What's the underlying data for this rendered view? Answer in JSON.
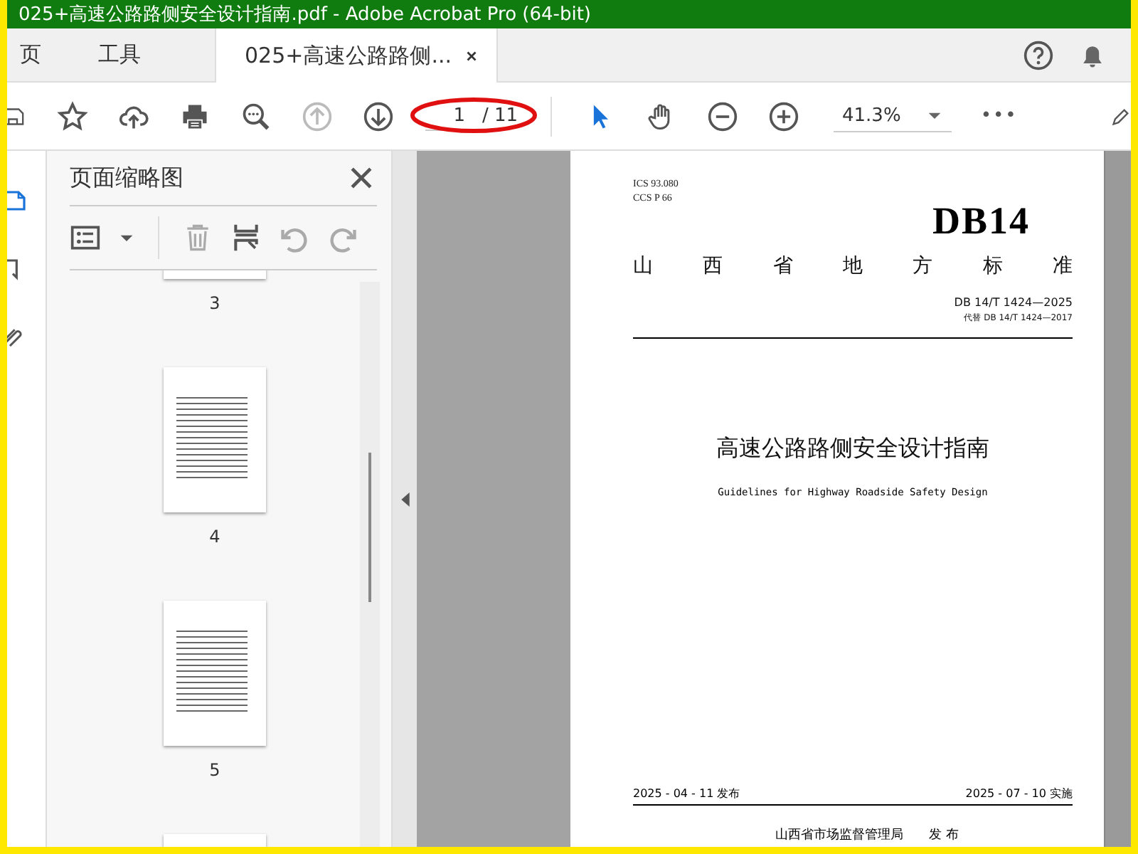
{
  "window": {
    "title": "025+高速公路路侧安全设计指南.pdf - Adobe Acrobat Pro (64-bit)"
  },
  "tabs": [
    {
      "label": "页",
      "selected": false
    },
    {
      "label": "工具",
      "selected": false
    },
    {
      "label": "025+高速公路路侧...",
      "selected": true
    }
  ],
  "toolbar": {
    "previous_page": {
      "disabled": true
    },
    "next_page": {
      "disabled": false
    },
    "page_number": "1",
    "page_count": "/ 11",
    "tools": [
      {
        "selected": true
      },
      {
        "selected": false
      }
    ],
    "zoom": "41.3%",
    "more": "•••"
  },
  "sidebar": {
    "items": [
      {
        "selected": true
      },
      {
        "selected": false
      },
      {
        "selected": false
      }
    ]
  },
  "thumbnails_panel": {
    "title": "页面缩略图",
    "delete": {
      "disabled": true
    },
    "rotate_left": {
      "disabled": true
    },
    "rotate_right": {
      "disabled": true
    },
    "pages": [
      {
        "label": "3"
      },
      {
        "label": "4"
      },
      {
        "label": "5"
      },
      {
        "cut_off": true
      }
    ]
  },
  "document": {
    "ics": "ICS  93.080",
    "ccs": "CCS  P 66",
    "logo": "DB14",
    "heading": [
      "山",
      "西",
      "省",
      "地",
      "方",
      "标",
      "准"
    ],
    "number": "DB 14/T  1424—2025",
    "replaces": "代替 DB 14/T 1424—2017",
    "title": "高速公路路侧安全设计指南",
    "subtitle": "Guidelines for Highway Roadside Safety Design",
    "issued": "2025 - 04 - 11 发布",
    "effective": "2025 - 07 - 10 实施",
    "publisher": "山西省市场监督管理局　　发 布"
  }
}
